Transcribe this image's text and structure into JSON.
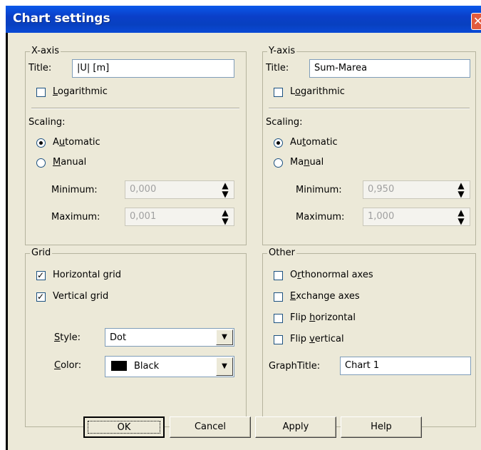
{
  "window": {
    "title": "Chart settings"
  },
  "xaxis": {
    "group_label": "X-axis",
    "title_label": "Title:",
    "title_value": "|U| [m]",
    "log_pre": "",
    "log_u": "L",
    "log_post": "ogarithmic",
    "log_checked": false,
    "scaling_label": "Scaling:",
    "auto_pre": "A",
    "auto_u": "u",
    "auto_post": "tomatic",
    "manual_pre": "",
    "manual_u": "M",
    "manual_post": "anual",
    "selected": "Automatic",
    "min_label": "Minimum:",
    "min_value": "0,000",
    "max_label": "Maximum:",
    "max_value": "0,001"
  },
  "yaxis": {
    "group_label": "Y-axis",
    "title_label": "Title:",
    "title_value": "Sum-Marea",
    "log_pre": "L",
    "log_u": "o",
    "log_post": "garithmic",
    "log_checked": false,
    "scaling_label": "Scaling:",
    "auto_pre": "Au",
    "auto_u": "t",
    "auto_post": "omatic",
    "manual_pre": "Ma",
    "manual_u": "n",
    "manual_post": "ual",
    "selected": "Automatic",
    "min_label": "Minimum:",
    "min_value": "0,950",
    "max_label": "Maximum:",
    "max_value": "1,000"
  },
  "grid": {
    "group_label": "Grid",
    "horizontal_label": "Horizontal grid",
    "horizontal_checked": true,
    "vertical_label": "Vertical grid",
    "vertical_checked": true,
    "style_pre": "",
    "style_u": "S",
    "style_post": "tyle:",
    "style_value": "Dot",
    "color_pre": "",
    "color_u": "C",
    "color_post": "olor:",
    "color_value": "Black",
    "color_swatch": "#000000"
  },
  "other": {
    "group_label": "Other",
    "orthonormal_pre": "O",
    "orthonormal_u": "r",
    "orthonormal_post": "thonormal axes",
    "exchange_pre": "",
    "exchange_u": "E",
    "exchange_post": "xchange axes",
    "fliph_pre": "Flip ",
    "fliph_u": "h",
    "fliph_post": "orizontal",
    "flipv_pre": "Flip ",
    "flipv_u": "v",
    "flipv_post": "ertical",
    "graphtitle_label": "GraphTitle:",
    "graphtitle_value": "Chart 1"
  },
  "buttons": {
    "ok": "OK",
    "cancel": "Cancel",
    "apply": "Apply",
    "help": "Help"
  },
  "icons": {
    "close": "close-icon",
    "spin": "spin-arrows-icon",
    "dropdown": "chevron-down-icon",
    "check": "checkmark-icon"
  },
  "colors": {
    "title_bar": "#0a4ad6",
    "dialog_bg": "#ece9d8",
    "close_button": "#e25b3d"
  }
}
